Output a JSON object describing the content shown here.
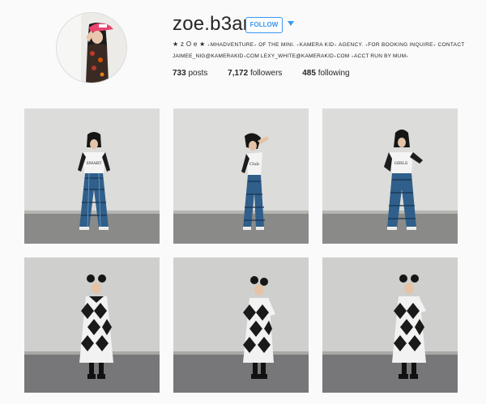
{
  "profile": {
    "username": "zoe.b3an",
    "follow_label": "FOLLOW",
    "bio_name": "★ z O e ★",
    "bio_rest": "₊MHADVENTURE₊ OF THE MINI. ₊KAMERA KID₊ AGENCY. ₊FOR BOOKING INQUIRE₊ CONTACT",
    "bio_line2": "JAIMEE_NIG@KAMERAKID₊COM LEXY_WHITE@KAMERAKID₊COM ₊ACCT RUN BY MUM₊",
    "stats": {
      "posts_count": "733",
      "posts_label": "posts",
      "followers_count": "7,172",
      "followers_label": "followers",
      "following_count": "485",
      "following_label": "following"
    }
  },
  "icons": {
    "dropdown": "caret-down-icon"
  },
  "colors": {
    "accent": "#3897f0",
    "background": "#fafafa"
  },
  "posts": [
    {
      "outfit": "raglan-tee-plaid-flares",
      "pose": "standing"
    },
    {
      "outfit": "raglan-tee-plaid-flares",
      "pose": "hand-on-hat"
    },
    {
      "outfit": "raglan-tee-plaid-flares",
      "pose": "hand-on-hip"
    },
    {
      "outfit": "argyle-dress",
      "pose": "standing"
    },
    {
      "outfit": "argyle-dress",
      "pose": "hand-on-hip"
    },
    {
      "outfit": "argyle-dress",
      "pose": "hand-on-hip"
    }
  ]
}
